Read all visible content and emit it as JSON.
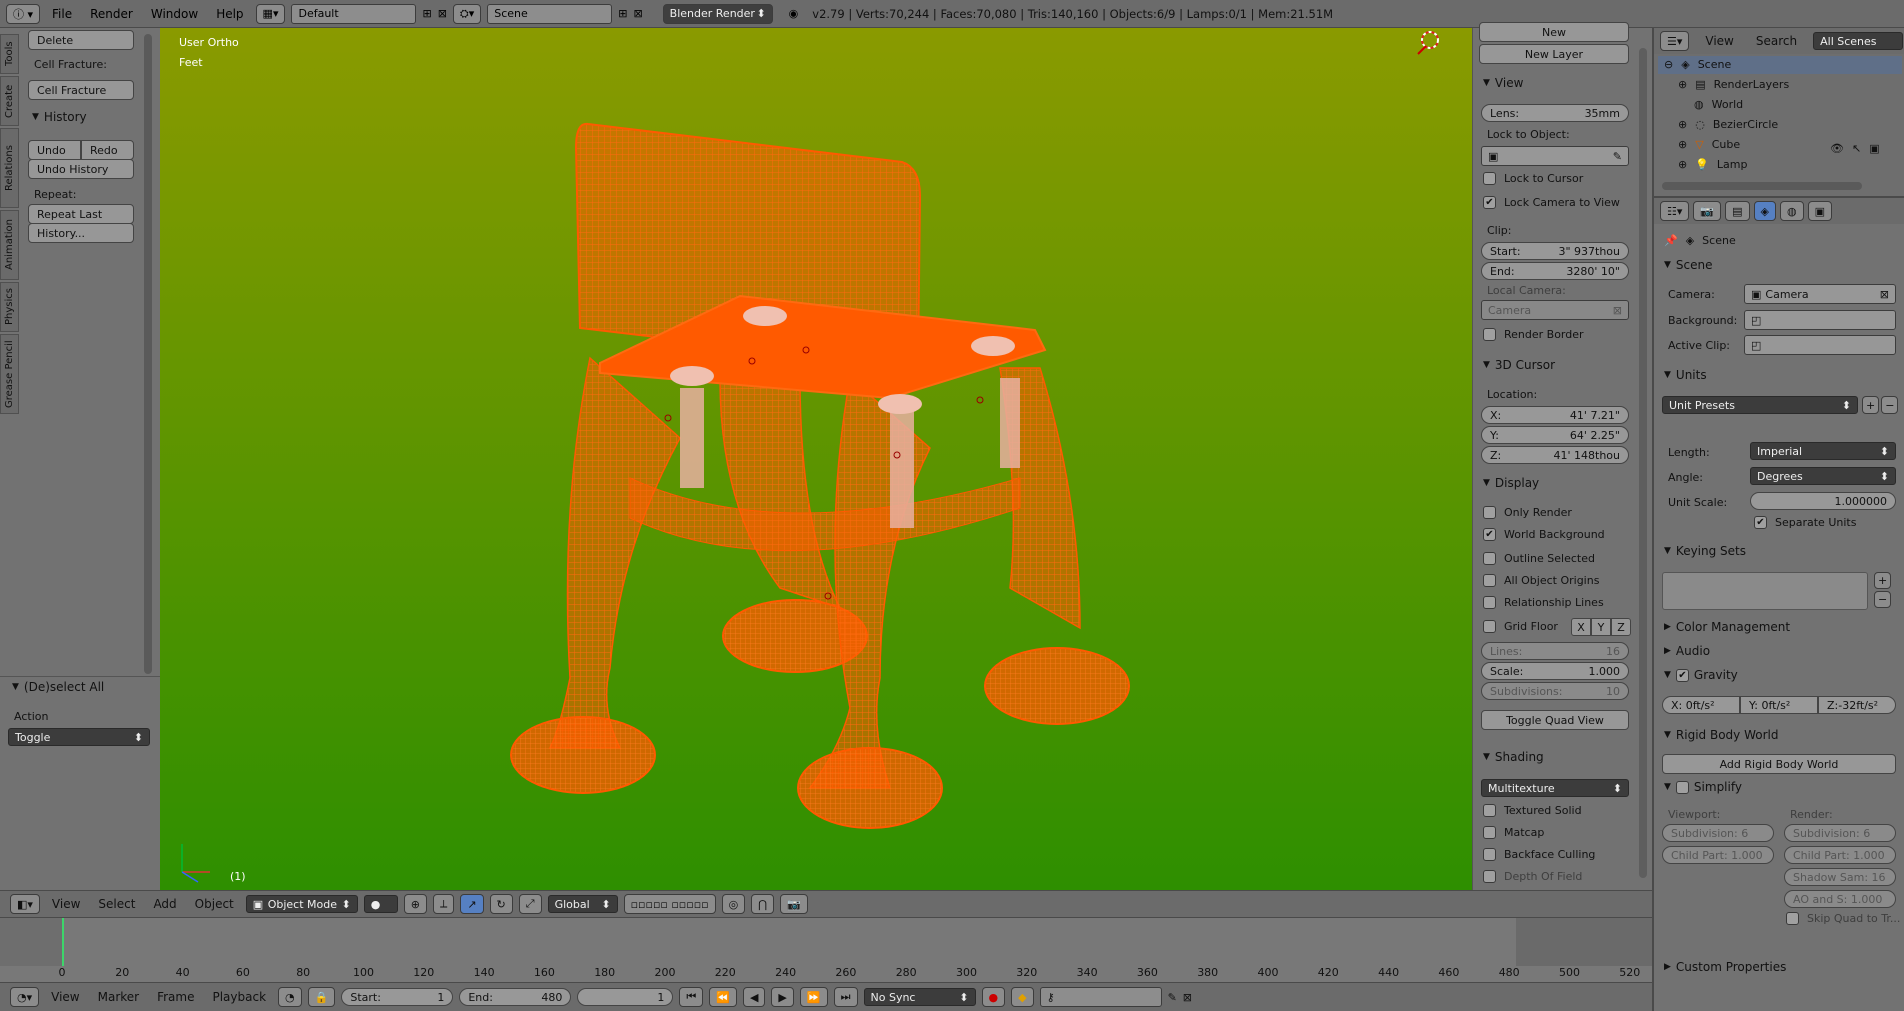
{
  "topbar": {
    "info_icon": "info-icon",
    "menus": [
      "File",
      "Render",
      "Window",
      "Help"
    ],
    "layout": "Default",
    "scene": "Scene",
    "engine": "Blender Render",
    "stats": "v2.79 | Verts:70,244 | Faces:70,080 | Tris:140,160 | Objects:6/9 | Lamps:0/1 | Mem:21.51M"
  },
  "toolshelf": {
    "tabs": [
      "Tools",
      "Create",
      "Relations",
      "Animation",
      "Physics",
      "Grease Pencil"
    ],
    "delete": "Delete",
    "cell_fracture_label": "Cell Fracture:",
    "cell_fracture_btn": "Cell Fracture",
    "history_title": "History",
    "undo": "Undo",
    "redo": "Redo",
    "undo_history": "Undo History",
    "repeat_label": "Repeat:",
    "repeat_last": "Repeat Last",
    "history_btn": "History...",
    "operator_title": "(De)select All",
    "action_label": "Action",
    "action_value": "Toggle"
  },
  "viewport": {
    "view_name": "User Ortho",
    "units": "Feet",
    "frame": "(1)"
  },
  "npanel": {
    "new": "New",
    "new_layer": "New Layer",
    "view_title": "View",
    "lens_label": "Lens:",
    "lens_value": "35mm",
    "lock_to_object": "Lock to Object:",
    "lock_to_cursor": "Lock to Cursor",
    "lock_camera": "Lock Camera to View",
    "clip_label": "Clip:",
    "clip_start_label": "Start:",
    "clip_start": "3\" 937thou",
    "clip_end_label": "End:",
    "clip_end": "3280' 10\"",
    "local_camera": "Local Camera:",
    "local_camera_value": "Camera",
    "render_border": "Render Border",
    "cursor_title": "3D Cursor",
    "location": "Location:",
    "x_label": "X:",
    "x": "41' 7.21\"",
    "y_label": "Y:",
    "y": "64' 2.25\"",
    "z_label": "Z:",
    "z": "41' 148thou",
    "display_title": "Display",
    "only_render": "Only Render",
    "world_background": "World Background",
    "outline_selected": "Outline Selected",
    "all_object_origins": "All Object Origins",
    "relationship_lines": "Relationship Lines",
    "grid_floor": "Grid Floor",
    "axis_x": "X",
    "axis_y": "Y",
    "axis_z": "Z",
    "lines_label": "Lines:",
    "lines": "16",
    "scale_label": "Scale:",
    "scale": "1.000",
    "subdiv_label": "Subdivisions:",
    "subdiv": "10",
    "toggle_quad": "Toggle Quad View",
    "shading_title": "Shading",
    "shading_mode": "Multitexture",
    "textured_solid": "Textured Solid",
    "matcap": "Matcap",
    "backface": "Backface Culling",
    "depth_of_field": "Depth Of Field"
  },
  "outliner": {
    "menus": [
      "View",
      "Search"
    ],
    "scope": "All Scenes",
    "items": [
      "Scene",
      "RenderLayers",
      "World",
      "BezierCircle",
      "Cube",
      "Lamp"
    ]
  },
  "properties": {
    "breadcrumb": "Scene",
    "scene_title": "Scene",
    "camera_label": "Camera:",
    "camera_value": "Camera",
    "background_label": "Background:",
    "active_clip_label": "Active Clip:",
    "units_title": "Units",
    "unit_presets": "Unit Presets",
    "length_label": "Length:",
    "length_value": "Imperial",
    "angle_label": "Angle:",
    "angle_value": "Degrees",
    "unit_scale_label": "Unit Scale:",
    "unit_scale": "1.000000",
    "separate_units": "Separate Units",
    "keying_sets_title": "Keying Sets",
    "color_management": "Color Management",
    "audio": "Audio",
    "gravity": "Gravity",
    "grav_x": "X:    0ft/s²",
    "grav_y": "Y:    0ft/s²",
    "grav_z": "Z:-32ft/s²",
    "rigid_body_world": "Rigid Body World",
    "add_rigid": "Add Rigid Body World",
    "simplify": "Simplify",
    "viewport_label": "Viewport:",
    "render_label": "Render:",
    "subdiv_vp": "Subdivision:   6",
    "subdiv_r": "Subdivision:   6",
    "child_vp": "Child Part: 1.000",
    "child_r": "Child Part: 1.000",
    "shadow": "Shadow Sam: 16",
    "ao": "AO and S:  1.000",
    "skip_quad": "Skip Quad to Tr...",
    "custom_props": "Custom Properties"
  },
  "header3d": {
    "menus": [
      "View",
      "Select",
      "Add",
      "Object"
    ],
    "mode": "Object Mode",
    "orientation": "Global"
  },
  "timeline": {
    "ticks": [
      "0",
      "20",
      "40",
      "60",
      "80",
      "100",
      "120",
      "140",
      "160",
      "180",
      "200",
      "220",
      "240",
      "260",
      "280",
      "300",
      "320",
      "340",
      "360",
      "380",
      "400",
      "420",
      "440",
      "460",
      "480",
      "500",
      "520"
    ],
    "menus": [
      "View",
      "Marker",
      "Frame",
      "Playback"
    ],
    "start_label": "Start:",
    "start": "1",
    "end_label": "End:",
    "end": "480",
    "current": "1",
    "sync": "No Sync"
  },
  "colors": {
    "viewport_top": "#8a9a00",
    "viewport_bottom": "#2e8f00",
    "mesh": "#ff5a00"
  }
}
